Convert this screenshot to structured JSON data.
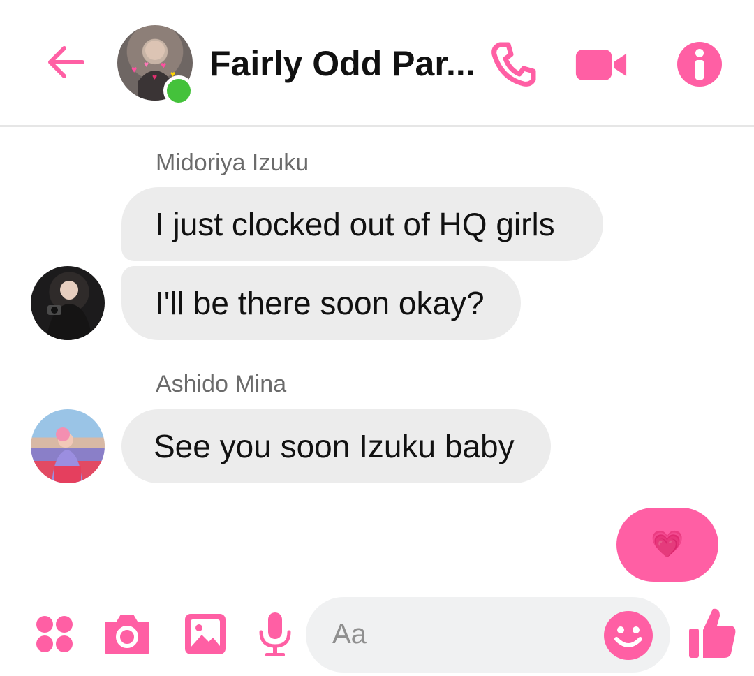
{
  "colors": {
    "accent": "#ff5fa4",
    "online": "#44c23b",
    "bubble": "#ececec"
  },
  "header": {
    "title": "Fairly Odd Par...",
    "icons": [
      "back-arrow-icon",
      "phone-icon",
      "video-camera-icon",
      "info-icon"
    ]
  },
  "messages": [
    {
      "sender": "Midoriya Izuku",
      "texts": [
        "I just clocked out of HQ girls",
        "I'll be there soon okay?"
      ]
    },
    {
      "sender": "Ashido Mina",
      "texts": [
        "See you soon Izuku baby"
      ]
    }
  ],
  "outgoing": {
    "emoji": "💗"
  },
  "composer": {
    "placeholder": "Aa",
    "icons": [
      "apps-icon",
      "camera-icon",
      "image-icon",
      "microphone-icon",
      "emoji-icon",
      "thumbs-up-icon"
    ]
  }
}
